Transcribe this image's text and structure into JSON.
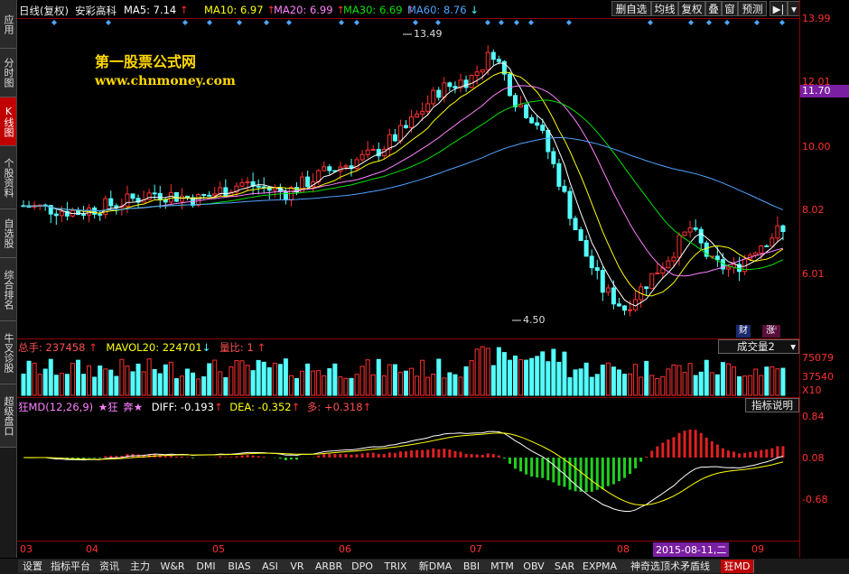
{
  "nav": {
    "items": [
      {
        "label": "应用"
      },
      {
        "label": "分时图"
      },
      {
        "label": "K线图",
        "active": true
      },
      {
        "label": "个股资料"
      },
      {
        "label": "自选股"
      },
      {
        "label": "综合排名"
      },
      {
        "label": "牛叉诊股"
      },
      {
        "label": "超级盘口"
      }
    ]
  },
  "header": {
    "period": "日线(复权)",
    "stock": "安彩高科",
    "ma5": "MA5: 7.14",
    "ma10": "MA10: 6.97",
    "ma20": "MA20: 6.99",
    "ma30": "MA30: 6.69",
    "ma60": "MA60: 8.76",
    "buttons": [
      "删自选",
      "均线",
      "复权",
      "叠",
      "窗",
      "预测"
    ]
  },
  "watermark": {
    "line1": "第一股票公式网",
    "line2": "www.chnmoney.com"
  },
  "price_axis": {
    "ticks": [
      "13.99",
      "12.01",
      "10.00",
      "8.02",
      "6.01"
    ],
    "current": "11.70"
  },
  "annotations": {
    "high": "13.49",
    "low": "4.50",
    "fin": "财",
    "zhang": "涨"
  },
  "volume": {
    "title": "总手: 237458",
    "mavol": "MAVOL20: 224701",
    "ratio": "量比: 1",
    "selector": "成交量2",
    "ticks": [
      "75079",
      "37540",
      "X10"
    ]
  },
  "indicator": {
    "title": "狂MD(12,26,9)",
    "star": "★狂",
    "ben": "奔★",
    "diff": "DIFF: -0.193",
    "dea": "DEA: -0.352",
    "duo": "多: +0.318",
    "help": "指标说明",
    "ticks": [
      "0.84",
      "0.08",
      "-0.68"
    ]
  },
  "date_axis": {
    "months": [
      "03",
      "04",
      "05",
      "06",
      "07",
      "08",
      "09"
    ],
    "cursor_date": "2015-08-11,二"
  },
  "tabs": [
    "设置",
    "指标平台",
    "资讯",
    "主力",
    "W&R",
    "DMI",
    "BIAS",
    "ASI",
    "VR",
    "ARBR",
    "DPO",
    "TRIX",
    "新DMA",
    "BBI",
    "MTM",
    "OBV",
    "SAR",
    "EXPMA",
    "神奇选顶术矛盾线",
    "狂MD"
  ],
  "colors": {
    "up": "#ff3030",
    "down": "#54ffff",
    "ma5": "#ffffff",
    "ma10": "#ffff00",
    "ma20": "#ff80ff",
    "ma30": "#00e000",
    "ma60": "#4fa3ff",
    "frame": "#8b0000"
  }
}
